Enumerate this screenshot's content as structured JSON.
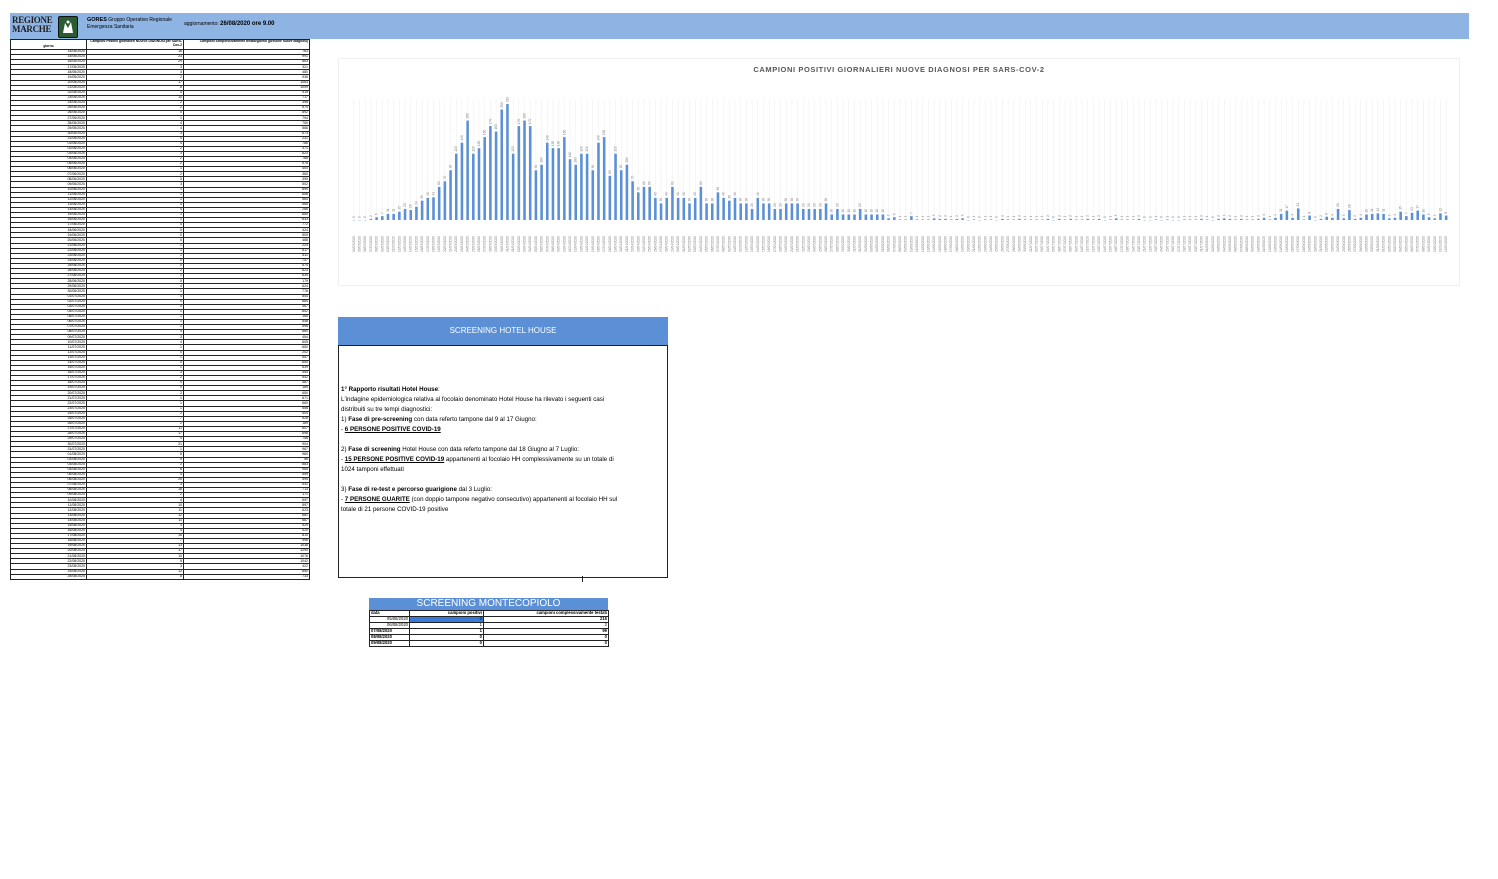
{
  "header": {
    "logo_line1": "REGIONE",
    "logo_line2": "MARCHE",
    "org_name": "GORES",
    "org_desc1": "Gruppo Operativo Regionale",
    "org_desc2": "Emergenza Sanitaria",
    "update_label": "aggiornamento:",
    "update_value": "26/08/2020 ore 9.00",
    "colors": {
      "band": "#8eb4e3",
      "badge": "#2a5b33"
    }
  },
  "daily_table": {
    "headers": [
      "giorno",
      "Campioni Positivi giornalieri NUOVE DIAGNOSI per SARS-Cov-2",
      "Campioni complessivamente testati/giorno (persone nuove diagnosi)"
    ],
    "rows": [
      [
        "14/05/2020",
        "16",
        "783"
      ],
      [
        "15/05/2020",
        "23",
        "991"
      ],
      [
        "16/05/2020",
        "29",
        "863"
      ],
      [
        "17/05/2020",
        "3",
        "321"
      ],
      [
        "18/05/2020",
        "4",
        "480"
      ],
      [
        "19/05/2020",
        "2",
        "936"
      ],
      [
        "20/05/2020",
        "17",
        "1063"
      ],
      [
        "21/05/2020",
        "8",
        "1009"
      ],
      [
        "22/05/2020",
        "4",
        "919"
      ],
      [
        "23/05/2020",
        "10",
        "717"
      ],
      [
        "24/05/2020",
        "2",
        "398"
      ],
      [
        "25/05/2020",
        "2",
        "574"
      ],
      [
        "26/05/2020",
        "0",
        "892"
      ],
      [
        "27/05/2020",
        "1",
        "794"
      ],
      [
        "28/05/2020",
        "4",
        "750"
      ],
      [
        "29/05/2020",
        "4",
        "566"
      ],
      [
        "30/05/2020",
        "3",
        "673"
      ],
      [
        "31/05/2020",
        "0",
        "231"
      ],
      [
        "01/06/2020",
        "4",
        "786"
      ],
      [
        "02/06/2020",
        "2",
        "371"
      ],
      [
        "03/06/2020",
        "3",
        "623"
      ],
      [
        "04/06/2020",
        "2",
        "768"
      ],
      [
        "05/06/2020",
        "2",
        "578"
      ],
      [
        "06/06/2020",
        "1",
        "400"
      ],
      [
        "07/06/2020",
        "2",
        "360"
      ],
      [
        "08/06/2020",
        "0",
        "399"
      ],
      [
        "09/06/2020",
        "3",
        "502"
      ],
      [
        "10/06/2020",
        "1",
        "890"
      ],
      [
        "11/06/2020",
        "1",
        "658"
      ],
      [
        "12/06/2020",
        "1",
        "564"
      ],
      [
        "13/06/2020",
        "4",
        "565"
      ],
      [
        "14/06/2020",
        "4",
        "266"
      ],
      [
        "15/06/2020",
        "1",
        "650"
      ],
      [
        "16/06/2020",
        "1",
        "633"
      ],
      [
        "17/06/2020",
        "4",
        "772"
      ],
      [
        "18/06/2020",
        "0",
        "424"
      ],
      [
        "19/06/2020",
        "0",
        "509"
      ],
      [
        "20/06/2020",
        "0",
        "488"
      ],
      [
        "21/06/2020",
        "1",
        "224"
      ],
      [
        "22/06/2020",
        "1",
        "517"
      ],
      [
        "23/06/2020",
        "1",
        "611"
      ],
      [
        "24/06/2020",
        "0",
        "747"
      ],
      [
        "25/06/2020",
        "0",
        "574"
      ],
      [
        "26/06/2020",
        "2",
        "623"
      ],
      [
        "27/06/2020",
        "1",
        "634"
      ],
      [
        "28/06/2020",
        "0",
        "179"
      ],
      [
        "29/06/2020",
        "4",
        "624"
      ],
      [
        "30/06/2020",
        "1",
        "776"
      ],
      [
        "01/07/2020",
        "4",
        "844"
      ],
      [
        "02/07/2020",
        "0",
        "884"
      ],
      [
        "03/07/2020",
        "0",
        "467"
      ],
      [
        "04/07/2020",
        "1",
        "602"
      ],
      [
        "05/07/2020",
        "1",
        "165"
      ],
      [
        "06/07/2020",
        "1",
        "548"
      ],
      [
        "07/07/2020",
        "1",
        "596"
      ],
      [
        "08/07/2020",
        "4",
        "660"
      ],
      [
        "09/07/2020",
        "3",
        "454"
      ],
      [
        "10/07/2020",
        "4",
        "605"
      ],
      [
        "11/07/2020",
        "1",
        "650"
      ],
      [
        "12/07/2020",
        "0",
        "202"
      ],
      [
        "13/07/2020",
        "1",
        "557"
      ],
      [
        "14/07/2020",
        "0",
        "650"
      ],
      [
        "15/07/2020",
        "1",
        "639"
      ],
      [
        "16/07/2020",
        "3",
        "454"
      ],
      [
        "17/07/2020",
        "2",
        "542"
      ],
      [
        "18/07/2020",
        "0",
        "487"
      ],
      [
        "19/07/2020",
        "0",
        "185"
      ],
      [
        "20/07/2020",
        "2",
        "650"
      ],
      [
        "21/07/2020",
        "1",
        "671"
      ],
      [
        "22/07/2020",
        "1",
        "660"
      ],
      [
        "23/07/2020",
        "1",
        "556"
      ],
      [
        "24/07/2020",
        "2",
        "504"
      ],
      [
        "25/07/2020",
        "7",
        "528"
      ],
      [
        "26/07/2020",
        "2",
        "189"
      ],
      [
        "27/07/2020",
        "11",
        "607"
      ],
      [
        "28/07/2020",
        "17",
        "698"
      ],
      [
        "29/07/2020",
        "4",
        "756"
      ],
      [
        "30/07/2020",
        "21",
        "904"
      ],
      [
        "31/07/2020",
        "1",
        "967"
      ],
      [
        "01/08/2020",
        "8",
        "960"
      ],
      [
        "02/08/2020",
        "0",
        "56"
      ],
      [
        "03/08/2020",
        "2",
        "883"
      ],
      [
        "04/08/2020",
        "6",
        "965"
      ],
      [
        "05/08/2020",
        "4",
        "559"
      ],
      [
        "06/08/2020",
        "20",
        "595"
      ],
      [
        "07/08/2020",
        "3",
        "531"
      ],
      [
        "08/08/2020",
        "18",
        "713"
      ],
      [
        "09/08/2020",
        "2",
        "171"
      ],
      [
        "10/08/2020",
        "4",
        "597"
      ],
      [
        "11/08/2020",
        "10",
        "597"
      ],
      [
        "12/08/2020",
        "11",
        "623"
      ],
      [
        "13/08/2020",
        "12",
        "681"
      ],
      [
        "14/08/2020",
        "11",
        "687"
      ],
      [
        "15/08/2020",
        "3",
        "529"
      ],
      [
        "16/08/2020",
        "4",
        "420"
      ],
      [
        "17/08/2020",
        "15",
        "810"
      ],
      [
        "18/08/2020",
        "7",
        "996"
      ],
      [
        "19/08/2020",
        "13",
        "1038"
      ],
      [
        "20/08/2020",
        "17",
        "1290"
      ],
      [
        "21/08/2020",
        "10",
        "1076"
      ],
      [
        "22/08/2020",
        "5",
        "1042"
      ],
      [
        "23/08/2020",
        "3",
        "422"
      ],
      [
        "24/08/2020",
        "12",
        "850"
      ],
      [
        "25/08/2020",
        "8",
        "733"
      ]
    ]
  },
  "chart_data": {
    "type": "bar",
    "title": "CAMPIONI POSITIVI GIORNALIERI NUOVE DIAGNOSI PER SARS-COV-2",
    "first_date": "04/03/2020",
    "last_date": "25/08/2020",
    "values": [
      0,
      0,
      0,
      2,
      5,
      7,
      11,
      11,
      15,
      20,
      18,
      24,
      35,
      40,
      41,
      60,
      70,
      90,
      120,
      140,
      180,
      120,
      130,
      150,
      170,
      160,
      200,
      210,
      120,
      170,
      180,
      170,
      90,
      100,
      140,
      130,
      130,
      150,
      110,
      100,
      120,
      120,
      90,
      140,
      150,
      80,
      120,
      90,
      100,
      70,
      50,
      60,
      60,
      40,
      30,
      40,
      60,
      40,
      40,
      30,
      40,
      60,
      30,
      30,
      50,
      40,
      35,
      40,
      30,
      30,
      20,
      40,
      30,
      30,
      20,
      20,
      30,
      30,
      30,
      20,
      20,
      20,
      20,
      30,
      10,
      20,
      10,
      10,
      10,
      20,
      10,
      10,
      10,
      10,
      3,
      5,
      1,
      1,
      7,
      1,
      1,
      1,
      3,
      2,
      2,
      1,
      2,
      3,
      0,
      1,
      0,
      1,
      1,
      0,
      2,
      1,
      1,
      2,
      1,
      1,
      1,
      1,
      2,
      0,
      2,
      1,
      2,
      1,
      1,
      2,
      1,
      2,
      0,
      1,
      3,
      1,
      1,
      1,
      2,
      0,
      0,
      1,
      0,
      1,
      0,
      0,
      1,
      1,
      1,
      2,
      1,
      0,
      2,
      3,
      2,
      1,
      2,
      1,
      1,
      2,
      4,
      1,
      4,
      11,
      17,
      4,
      21,
      1,
      8,
      0,
      2,
      6,
      4,
      20,
      3,
      18,
      2,
      4,
      10,
      11,
      12,
      11,
      3,
      4,
      15,
      7,
      13,
      17,
      10,
      5,
      3,
      12,
      8
    ],
    "color": "#5b8fd6"
  },
  "hotel_house": {
    "title": "SCREENING HOTEL HOUSE",
    "report_title": "1° Rapporto  risultati Hotel House",
    "intro1": "L'indagine epidemiologica relativa al focolaio denominato Hotel House ha rilevato i seguenti casi",
    "intro2": "distribuiti su tre tempi diagnostici:",
    "p1_num": "1) ",
    "p1_bold": "Fase di pre-screening",
    "p1_rest": " con data referto tampone dal 9 al 17 Giugno:",
    "p1_res": "6 PERSONE POSITIVE COVID-19",
    "p2_num": "2) ",
    "p2_bold": "Fase di screening",
    "p2_rest": " Hotel House con data referto tampone dal 18 Giugno al 7 Luglio:",
    "p2_res": "15 PERSONE POSITIVE COVID-19",
    "p2_res_rest": " appartenenti al focolaio HH complessivamente su un totale di",
    "p2_line3": "1024 tamponi effettuati",
    "p3_num": "3) ",
    "p3_bold": "Fase di re-test e percorso guarigione",
    "p3_rest": " dal 3 Luglio:",
    "p3_res": "7 PERSONE GUARITE",
    "p3_res_rest": " (con doppio tampone negativo consecutivo) appartenenti al focolaio HH sul",
    "p3_line3": "totale di 21 persone COVID-19 positive",
    "dash": "- "
  },
  "montecopiolo": {
    "title": "SCREENING MONTECOPIOLO",
    "headers": [
      "data",
      "campioni positivi",
      "campioni complessivamente testati"
    ],
    "rows": [
      [
        "05/08/2020",
        "0",
        "215"
      ],
      [
        "06/08/2020",
        "1",
        "2"
      ],
      [
        "07/08/2020",
        "1",
        "99"
      ],
      [
        "08/08/2020",
        "0",
        "0"
      ],
      [
        "09/08/2020",
        "0",
        "0"
      ]
    ]
  }
}
